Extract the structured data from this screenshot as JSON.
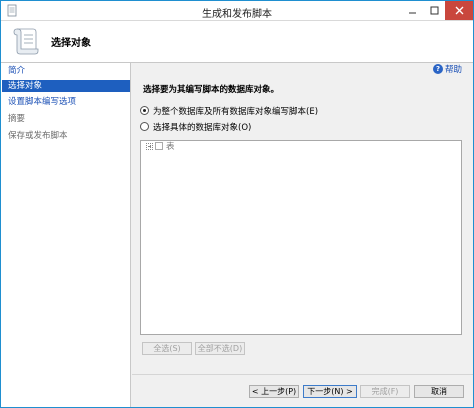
{
  "window": {
    "title": "生成和发布脚本"
  },
  "header": {
    "title": "选择对象"
  },
  "sidebar": {
    "items": [
      {
        "label": "简介",
        "state": "link"
      },
      {
        "label": "选择对象",
        "state": "active"
      },
      {
        "label": "设置脚本编写选项",
        "state": "link"
      },
      {
        "label": "摘要",
        "state": "disabled"
      },
      {
        "label": "保存或发布脚本",
        "state": "disabled"
      }
    ]
  },
  "help": {
    "label": "帮助"
  },
  "main": {
    "prompt": "选择要为其编写脚本的数据库对象。",
    "options": [
      {
        "label": "为整个数据库及所有数据库对象编写脚本(E)",
        "checked": true
      },
      {
        "label": "选择具体的数据库对象(O)",
        "checked": false
      }
    ],
    "tree": [
      {
        "label": "表"
      }
    ],
    "select_all_label": "全选(S)",
    "deselect_all_label": "全部不选(D)"
  },
  "footer": {
    "prev_label": "< 上一步(P)",
    "next_label": "下一步(N) >",
    "finish_label": "完成(F)",
    "cancel_label": "取消"
  },
  "colors": {
    "accent": "#1e5fbf",
    "link": "#1a4fb5",
    "close_button": "#c9473d",
    "window_border": "#1f8fd0"
  },
  "icons": {
    "app": "script-scroll-icon",
    "header": "script-scroll-icon",
    "help": "help-icon",
    "minimize": "minimize-icon",
    "maximize": "maximize-icon",
    "close": "close-icon"
  }
}
